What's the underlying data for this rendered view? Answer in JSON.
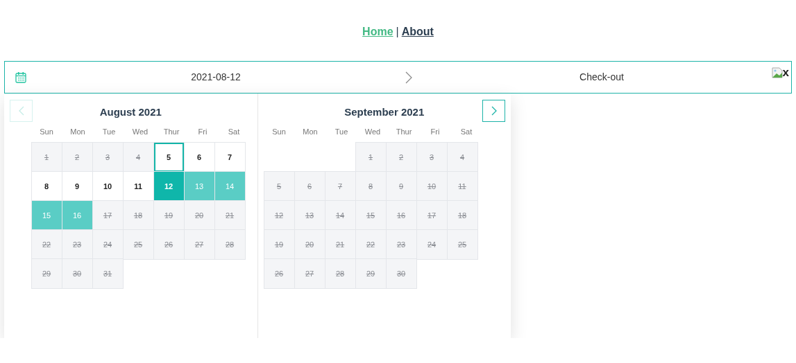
{
  "nav": {
    "links": [
      {
        "label": "Home",
        "selected": true
      },
      {
        "label": "About",
        "selected": false
      }
    ],
    "separator": "|"
  },
  "date_bar": {
    "check_in": "2021-08-12",
    "check_out": {
      "placeholder": "Check-out"
    },
    "close_alt": "x"
  },
  "calendar": {
    "prev_disabled": true,
    "next_disabled": false,
    "months": [
      {
        "title": "August 2021",
        "weekdays": [
          "Sun",
          "Mon",
          "Tue",
          "Wed",
          "Thur",
          "Fri",
          "Sat"
        ],
        "weeks": [
          [
            {
              "kind": "day",
              "day": "1",
              "disabled": true,
              "focused": false,
              "selected": false,
              "in_range": false
            },
            {
              "kind": "day",
              "day": "2",
              "disabled": true,
              "focused": false,
              "selected": false,
              "in_range": false
            },
            {
              "kind": "day",
              "day": "3",
              "disabled": true,
              "focused": false,
              "selected": false,
              "in_range": false
            },
            {
              "kind": "day",
              "day": "4",
              "disabled": true,
              "focused": false,
              "selected": false,
              "in_range": false
            },
            {
              "kind": "day",
              "day": "5",
              "disabled": false,
              "focused": true,
              "selected": false,
              "in_range": false
            },
            {
              "kind": "day",
              "day": "6",
              "disabled": false,
              "focused": false,
              "selected": false,
              "in_range": false
            },
            {
              "kind": "day",
              "day": "7",
              "disabled": false,
              "focused": false,
              "selected": false,
              "in_range": false
            }
          ],
          [
            {
              "kind": "day",
              "day": "8",
              "disabled": false,
              "focused": false,
              "selected": false,
              "in_range": false
            },
            {
              "kind": "day",
              "day": "9",
              "disabled": false,
              "focused": false,
              "selected": false,
              "in_range": false
            },
            {
              "kind": "day",
              "day": "10",
              "disabled": false,
              "focused": false,
              "selected": false,
              "in_range": false
            },
            {
              "kind": "day",
              "day": "11",
              "disabled": false,
              "focused": false,
              "selected": false,
              "in_range": false
            },
            {
              "kind": "day",
              "day": "12",
              "disabled": false,
              "focused": false,
              "selected": true,
              "in_range": false
            },
            {
              "kind": "day",
              "day": "13",
              "disabled": false,
              "focused": false,
              "selected": false,
              "in_range": true
            },
            {
              "kind": "day",
              "day": "14",
              "disabled": false,
              "focused": false,
              "selected": false,
              "in_range": true
            }
          ],
          [
            {
              "kind": "day",
              "day": "15",
              "disabled": false,
              "focused": false,
              "selected": false,
              "in_range": true
            },
            {
              "kind": "day",
              "day": "16",
              "disabled": false,
              "focused": false,
              "selected": false,
              "in_range": true
            },
            {
              "kind": "day",
              "day": "17",
              "disabled": true,
              "focused": false,
              "selected": false,
              "in_range": false
            },
            {
              "kind": "day",
              "day": "18",
              "disabled": true,
              "focused": false,
              "selected": false,
              "in_range": false
            },
            {
              "kind": "day",
              "day": "19",
              "disabled": true,
              "focused": false,
              "selected": false,
              "in_range": false
            },
            {
              "kind": "day",
              "day": "20",
              "disabled": true,
              "focused": false,
              "selected": false,
              "in_range": false
            },
            {
              "kind": "day",
              "day": "21",
              "disabled": true,
              "focused": false,
              "selected": false,
              "in_range": false
            }
          ],
          [
            {
              "kind": "day",
              "day": "22",
              "disabled": true,
              "focused": false,
              "selected": false,
              "in_range": false
            },
            {
              "kind": "day",
              "day": "23",
              "disabled": true,
              "focused": false,
              "selected": false,
              "in_range": false
            },
            {
              "kind": "day",
              "day": "24",
              "disabled": true,
              "focused": false,
              "selected": false,
              "in_range": false
            },
            {
              "kind": "day",
              "day": "25",
              "disabled": true,
              "focused": false,
              "selected": false,
              "in_range": false
            },
            {
              "kind": "day",
              "day": "26",
              "disabled": true,
              "focused": false,
              "selected": false,
              "in_range": false
            },
            {
              "kind": "day",
              "day": "27",
              "disabled": true,
              "focused": false,
              "selected": false,
              "in_range": false
            },
            {
              "kind": "day",
              "day": "28",
              "disabled": true,
              "focused": false,
              "selected": false,
              "in_range": false
            }
          ],
          [
            {
              "kind": "day",
              "day": "29",
              "disabled": true,
              "focused": false,
              "selected": false,
              "in_range": false
            },
            {
              "kind": "day",
              "day": "30",
              "disabled": true,
              "focused": false,
              "selected": false,
              "in_range": false
            },
            {
              "kind": "day",
              "day": "31",
              "disabled": true,
              "focused": false,
              "selected": false,
              "in_range": false
            }
          ]
        ]
      },
      {
        "title": "September 2021",
        "weekdays": [
          "Sun",
          "Mon",
          "Tue",
          "Wed",
          "Thur",
          "Fri",
          "Sat"
        ],
        "weeks": [
          [
            {
              "kind": "blank"
            },
            {
              "kind": "blank"
            },
            {
              "kind": "blank"
            },
            {
              "kind": "day",
              "day": "1",
              "disabled": true,
              "focused": false,
              "selected": false,
              "in_range": false
            },
            {
              "kind": "day",
              "day": "2",
              "disabled": true,
              "focused": false,
              "selected": false,
              "in_range": false
            },
            {
              "kind": "day",
              "day": "3",
              "disabled": true,
              "focused": false,
              "selected": false,
              "in_range": false
            },
            {
              "kind": "day",
              "day": "4",
              "disabled": true,
              "focused": false,
              "selected": false,
              "in_range": false
            }
          ],
          [
            {
              "kind": "day",
              "day": "5",
              "disabled": true,
              "focused": false,
              "selected": false,
              "in_range": false
            },
            {
              "kind": "day",
              "day": "6",
              "disabled": true,
              "focused": false,
              "selected": false,
              "in_range": false
            },
            {
              "kind": "day",
              "day": "7",
              "disabled": true,
              "focused": false,
              "selected": false,
              "in_range": false
            },
            {
              "kind": "day",
              "day": "8",
              "disabled": true,
              "focused": false,
              "selected": false,
              "in_range": false
            },
            {
              "kind": "day",
              "day": "9",
              "disabled": true,
              "focused": false,
              "selected": false,
              "in_range": false
            },
            {
              "kind": "day",
              "day": "10",
              "disabled": true,
              "focused": false,
              "selected": false,
              "in_range": false
            },
            {
              "kind": "day",
              "day": "11",
              "disabled": true,
              "focused": false,
              "selected": false,
              "in_range": false
            }
          ],
          [
            {
              "kind": "day",
              "day": "12",
              "disabled": true,
              "focused": false,
              "selected": false,
              "in_range": false
            },
            {
              "kind": "day",
              "day": "13",
              "disabled": true,
              "focused": false,
              "selected": false,
              "in_range": false
            },
            {
              "kind": "day",
              "day": "14",
              "disabled": true,
              "focused": false,
              "selected": false,
              "in_range": false
            },
            {
              "kind": "day",
              "day": "15",
              "disabled": true,
              "focused": false,
              "selected": false,
              "in_range": false
            },
            {
              "kind": "day",
              "day": "16",
              "disabled": true,
              "focused": false,
              "selected": false,
              "in_range": false
            },
            {
              "kind": "day",
              "day": "17",
              "disabled": true,
              "focused": false,
              "selected": false,
              "in_range": false
            },
            {
              "kind": "day",
              "day": "18",
              "disabled": true,
              "focused": false,
              "selected": false,
              "in_range": false
            }
          ],
          [
            {
              "kind": "day",
              "day": "19",
              "disabled": true,
              "focused": false,
              "selected": false,
              "in_range": false
            },
            {
              "kind": "day",
              "day": "20",
              "disabled": true,
              "focused": false,
              "selected": false,
              "in_range": false
            },
            {
              "kind": "day",
              "day": "21",
              "disabled": true,
              "focused": false,
              "selected": false,
              "in_range": false
            },
            {
              "kind": "day",
              "day": "22",
              "disabled": true,
              "focused": false,
              "selected": false,
              "in_range": false
            },
            {
              "kind": "day",
              "day": "23",
              "disabled": true,
              "focused": false,
              "selected": false,
              "in_range": false
            },
            {
              "kind": "day",
              "day": "24",
              "disabled": true,
              "focused": false,
              "selected": false,
              "in_range": false
            },
            {
              "kind": "day",
              "day": "25",
              "disabled": true,
              "focused": false,
              "selected": false,
              "in_range": false
            }
          ],
          [
            {
              "kind": "day",
              "day": "26",
              "disabled": true,
              "focused": false,
              "selected": false,
              "in_range": false
            },
            {
              "kind": "day",
              "day": "27",
              "disabled": true,
              "focused": false,
              "selected": false,
              "in_range": false
            },
            {
              "kind": "day",
              "day": "28",
              "disabled": true,
              "focused": false,
              "selected": false,
              "in_range": false
            },
            {
              "kind": "day",
              "day": "29",
              "disabled": true,
              "focused": false,
              "selected": false,
              "in_range": false
            },
            {
              "kind": "day",
              "day": "30",
              "disabled": true,
              "focused": false,
              "selected": false,
              "in_range": false
            }
          ]
        ]
      }
    ]
  }
}
